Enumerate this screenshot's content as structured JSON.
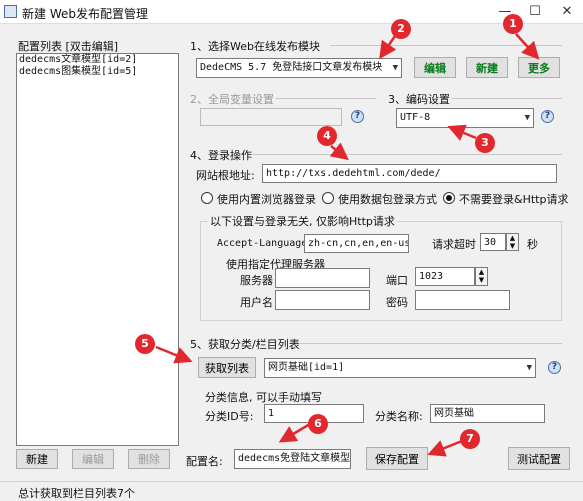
{
  "window": {
    "title": "新建 Web发布配置管理"
  },
  "left_panel": {
    "title": "配置列表 [双击编辑]",
    "items": [
      "dedecms文章模型[id=2]",
      "dedecms图集模型[id=5]"
    ],
    "buttons": {
      "new": "新建",
      "edit": "编辑",
      "delete": "删除"
    }
  },
  "section1": {
    "title": "1、选择Web在线发布模块",
    "module_value": "DedeCMS 5.7 免登陆接口文章发布模块",
    "buttons": {
      "edit": "编辑",
      "new": "新建",
      "more": "更多"
    }
  },
  "section2": {
    "title": "2、全局变量设置"
  },
  "section3": {
    "title": "3、编码设置",
    "encoding_value": "UTF-8"
  },
  "section4": {
    "title": "4、登录操作",
    "root_url_label": "网站根地址:",
    "root_url_value": "http://txs.dedehtml.com/dede/",
    "radios": [
      "使用内置浏览器登录",
      "使用数据包登录方式",
      "不需要登录&Http请求"
    ],
    "http_note": "以下设置与登录无关, 仅影响Http请求",
    "accept_language_label": "Accept-Language",
    "accept_language_value": "zh-cn,cn,en,en-us",
    "timeout_label": "请求超时",
    "timeout_value": "30",
    "timeout_unit": "秒",
    "proxy": {
      "title": "使用指定代理服务器",
      "server_label": "服务器",
      "port_label": "端口",
      "port_value": "1023",
      "username_label": "用户名",
      "password_label": "密码"
    }
  },
  "section5": {
    "title": "5、获取分类/栏目列表",
    "fetch_button": "获取列表",
    "category_value": "网页基础[id=1]",
    "info_note": "分类信息, 可以手动填写",
    "cat_id_label": "分类ID号:",
    "cat_id_value": "1",
    "cat_name_label": "分类名称:",
    "cat_name_value": "网页基础"
  },
  "bottom": {
    "config_name_label": "配置名:",
    "config_name_value": "dedecms免登陆文章模型",
    "save_button": "保存配置",
    "test_button": "测试配置"
  },
  "status": {
    "text": "总计获取到栏目列表7个"
  },
  "markers": [
    "1",
    "2",
    "3",
    "4",
    "5",
    "6",
    "7"
  ],
  "colors": {
    "marker": "#e0282e",
    "accent_button_text": "#0a7a1a"
  }
}
